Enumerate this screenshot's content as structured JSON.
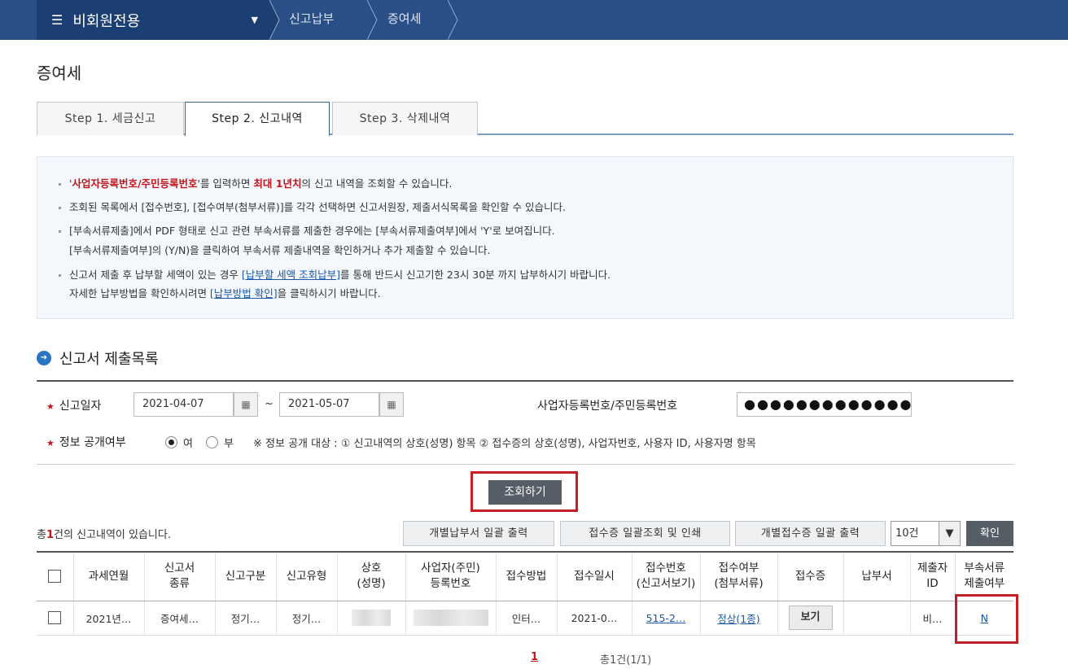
{
  "topbar": {
    "menu_title": "비회원전용",
    "crumbs": [
      "신고납부",
      "증여세"
    ]
  },
  "page_title": "증여세",
  "tabs": [
    "Step 1. 세금신고",
    "Step 2. 신고내역",
    "Step 3. 삭제내역"
  ],
  "info": {
    "l1_a": "'",
    "l1_red1": "사업자등록번호/주민등록번호",
    "l1_b": "'를 입력하면 ",
    "l1_red2": "최대 1년치",
    "l1_c": "의 신고 내역을 조회할 수 있습니다.",
    "l2": "조회된 목록에서 [접수번호], [접수여부(첨부서류)]를 각각 선택하면 신고서원장, 제출서식목록을 확인할 수 있습니다.",
    "l3": "[부속서류제출]에서 PDF 형태로 신고 관련 부속서류를 제출한 경우에는 [부속서류제출여부]에서 'Y'로 보여집니다.",
    "l4": "[부속서류제출여부]의 (Y/N)을 클릭하여 부속서류 제출내역을 확인하거나 추가 제출할 수 있습니다.",
    "l5_a": "신고서 제출 후 납부할 세액이 있는 경우 ",
    "l5_link": "[납부할 세액 조회납부]",
    "l5_b": "를 통해 반드시 신고기한 23시 30분 까지 납부하시기 바랍니다.",
    "l6_a": "자세한 납부방법을 확인하시려면 ",
    "l6_link": "[납부방법 확인]",
    "l6_b": "을 클릭하시기 바랍니다."
  },
  "section_title": "신고서 제출목록",
  "search": {
    "date_label": "신고일자",
    "date_from": "2021-04-07",
    "tilde": "~",
    "date_to": "2021-05-07",
    "id_label": "사업자등록번호/주민등록번호",
    "id_value": "●●●●●●●●●●●●●",
    "disclose_label": "정보 공개여부",
    "yes": "여",
    "no": "부",
    "note": "※ 정보 공개 대상 : ① 신고내역의 상호(성명) 항목 ② 접수증의 상호(성명), 사업자번호, 사용자 ID, 사용자명 항목",
    "button": "조회하기"
  },
  "list": {
    "total_pre": "총",
    "total_count": "1",
    "total_post": "건의 신고내역이 있습니다.",
    "btn_batch_tax": "개별납부서 일괄 출력",
    "btn_batch_receipt": "접수증 일괄조회 및 인쇄",
    "btn_batch_each": "개별접수증 일괄 출력",
    "page_size": "10건",
    "confirm": "확인"
  },
  "table": {
    "headers": [
      "",
      "과세연월",
      "신고서\n종류",
      "신고구분",
      "신고유형",
      "상호\n(성명)",
      "사업자(주민)\n등록번호",
      "접수방법",
      "접수일시",
      "접수번호\n(신고서보기)",
      "접수여부\n(첨부서류)",
      "접수증",
      "납부서",
      "제출자\nID",
      "부속서류\n제출여부"
    ],
    "row": {
      "period": "2021년…",
      "kind": "증여세…",
      "category": "정기…",
      "type": "정기…",
      "method": "인터…",
      "datetime": "2021-0…",
      "receipt_no": "515-2…",
      "status": "정상(1종)",
      "view": "보기",
      "submitter": "비…",
      "attached": "N"
    }
  },
  "pager": {
    "current": "1",
    "summary": "총1건(1/1)"
  },
  "colors": {
    "nav": "#2a4f86",
    "accent_red": "#c4161c",
    "highlight": "#c21f24"
  }
}
